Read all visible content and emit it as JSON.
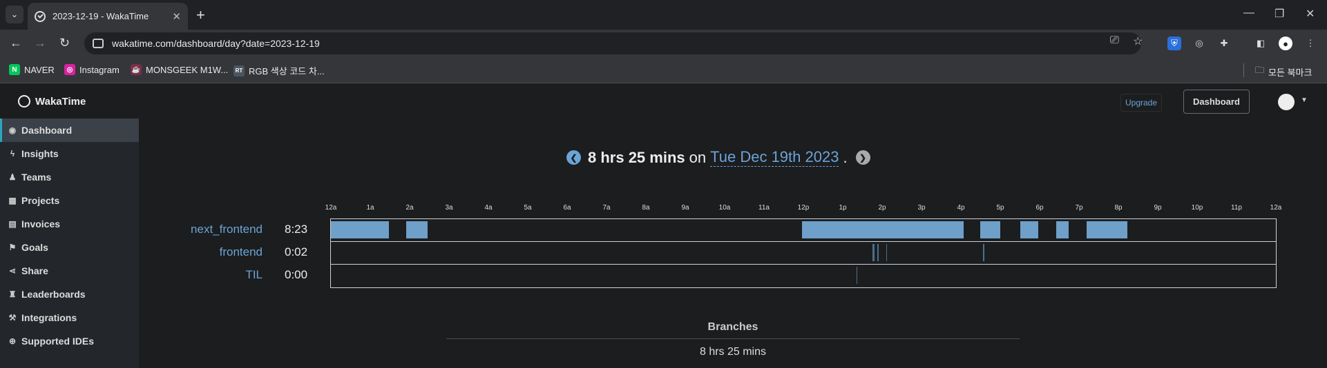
{
  "browser": {
    "tab_title": "2023-12-19 - WakaTime",
    "url": "wakatime.com/dashboard/day?date=2023-12-19",
    "bookmarks": [
      {
        "label": "NAVER",
        "icon": "naver-icon",
        "color": "#03c75a",
        "glyph": "N"
      },
      {
        "label": "Instagram",
        "icon": "instagram-icon",
        "color": "#d6249f",
        "glyph": "◎"
      },
      {
        "label": "MONSGEEK M1W...",
        "icon": "monsgeek-icon",
        "color": "#7a2d4a",
        "glyph": "☕"
      },
      {
        "label": "RGB 색상 코드 차...",
        "icon": "rgb-icon",
        "color": "#4a5560",
        "glyph": "RT"
      }
    ],
    "all_bookmarks": "모든 북마크"
  },
  "app": {
    "brand": "WakaTime",
    "upgrade": "Upgrade",
    "dashboard_btn": "Dashboard"
  },
  "sidebar": {
    "items": [
      {
        "label": "Dashboard",
        "icon": "dashboard-icon",
        "glyph": "◉"
      },
      {
        "label": "Insights",
        "icon": "bolt-icon",
        "glyph": "ϟ"
      },
      {
        "label": "Teams",
        "icon": "users-icon",
        "glyph": "👥"
      },
      {
        "label": "Projects",
        "icon": "grid-icon",
        "glyph": "▦"
      },
      {
        "label": "Invoices",
        "icon": "file-icon",
        "glyph": "▤"
      },
      {
        "label": "Goals",
        "icon": "flag-icon",
        "glyph": "⚑"
      },
      {
        "label": "Share",
        "icon": "share-icon",
        "glyph": "⋖"
      },
      {
        "label": "Leaderboards",
        "icon": "trophy-icon",
        "glyph": "♜"
      },
      {
        "label": "Integrations",
        "icon": "wrench-icon",
        "glyph": "🔧"
      },
      {
        "label": "Supported IDEs",
        "icon": "plus-circle-icon",
        "glyph": "⊕"
      }
    ]
  },
  "summary": {
    "total": "8 hrs 25 mins",
    "on": "on",
    "date": "Tue Dec 19th 2023",
    "period": "."
  },
  "timeline": {
    "ticks": [
      "12a",
      "1a",
      "2a",
      "3a",
      "4a",
      "5a",
      "6a",
      "7a",
      "8a",
      "9a",
      "10a",
      "11a",
      "12p",
      "1p",
      "2p",
      "3p",
      "4p",
      "5p",
      "6p",
      "7p",
      "8p",
      "9p",
      "10p",
      "11p",
      "12a"
    ],
    "projects": [
      {
        "name": "next_frontend",
        "time": "8:23",
        "segments": [
          [
            0,
            1.48
          ],
          [
            1.92,
            2.46
          ],
          [
            11.96,
            16.07
          ],
          [
            16.49,
            17.0
          ],
          [
            17.5,
            17.97
          ],
          [
            18.42,
            18.73
          ],
          [
            19.2,
            20.23
          ]
        ]
      },
      {
        "name": "frontend",
        "time": "0:02",
        "segments": [
          [
            13.76,
            13.8
          ],
          [
            13.88,
            13.9
          ],
          [
            14.1,
            14.13
          ],
          [
            16.56,
            16.59
          ]
        ]
      },
      {
        "name": "TIL",
        "time": "0:00",
        "segments": [
          [
            13.35,
            13.37
          ]
        ]
      }
    ]
  },
  "branches": {
    "title": "Branches",
    "total": "8 hrs 25 mins"
  }
}
